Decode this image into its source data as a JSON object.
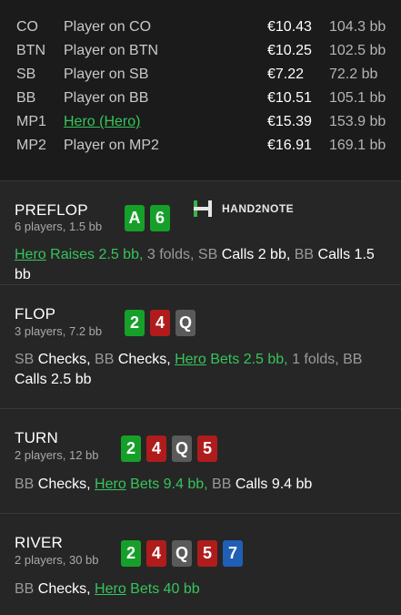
{
  "players": [
    {
      "pos": "CO",
      "name": "Player on CO",
      "stack": "€10.43",
      "bb": "104.3 bb",
      "hero": false
    },
    {
      "pos": "BTN",
      "name": "Player on BTN",
      "stack": "€10.25",
      "bb": "102.5 bb",
      "hero": false
    },
    {
      "pos": "SB",
      "name": "Player on SB",
      "stack": "€7.22",
      "bb": "72.2 bb",
      "hero": false
    },
    {
      "pos": "BB",
      "name": "Player on BB",
      "stack": "€10.51",
      "bb": "105.1 bb",
      "hero": false
    },
    {
      "pos": "MP1",
      "name": "Hero (Hero)",
      "stack": "€15.39",
      "bb": "153.9 bb",
      "hero": true
    },
    {
      "pos": "MP2",
      "name": "Player on MP2",
      "stack": "€16.91",
      "bb": "169.1 bb",
      "hero": false
    }
  ],
  "logo": {
    "text": "HAND2NOTE",
    "icon": "hand2note-logo-icon"
  },
  "streets": {
    "preflop": {
      "title": "PREFLOP",
      "sub": "6 players, 1.5 bb",
      "cards": [
        {
          "rank": "A",
          "suit": "clubs"
        },
        {
          "rank": "6",
          "suit": "clubs"
        }
      ],
      "actions": {
        "a1": "Hero",
        "a2": " Raises 2.5 bb,",
        "a3": " 3 folds,",
        "a4": " SB",
        "a5": " Calls 2 bb,",
        "a6": " BB",
        "a7": " Calls 1.5 bb"
      }
    },
    "flop": {
      "title": "FLOP",
      "sub": "3 players, 7.2 bb",
      "cards": [
        {
          "rank": "2",
          "suit": "clubs"
        },
        {
          "rank": "4",
          "suit": "hearts"
        },
        {
          "rank": "Q",
          "suit": "spades"
        }
      ],
      "actions": {
        "a1": "SB",
        "a2": " Checks,",
        "a3": " BB",
        "a4": " Checks,",
        "a5": "Hero",
        "a6": " Bets 2.5 bb,",
        "a7": " 1 folds,",
        "a8": " BB",
        "a9": " Calls 2.5 bb"
      }
    },
    "turn": {
      "title": "TURN",
      "sub": "2 players, 12 bb",
      "cards": [
        {
          "rank": "2",
          "suit": "clubs"
        },
        {
          "rank": "4",
          "suit": "hearts"
        },
        {
          "rank": "Q",
          "suit": "spades"
        },
        {
          "rank": "5",
          "suit": "hearts"
        }
      ],
      "actions": {
        "a1": "BB",
        "a2": " Checks,",
        "a3": "Hero",
        "a4": " Bets 9.4 bb,",
        "a5": " BB",
        "a6": " Calls 9.4 bb"
      }
    },
    "river": {
      "title": "RIVER",
      "sub": "2 players, 30 bb",
      "cards": [
        {
          "rank": "2",
          "suit": "clubs"
        },
        {
          "rank": "4",
          "suit": "hearts"
        },
        {
          "rank": "Q",
          "suit": "spades"
        },
        {
          "rank": "5",
          "suit": "hearts"
        },
        {
          "rank": "7",
          "suit": "diamonds"
        }
      ],
      "actions": {
        "a1": "BB",
        "a2": " Checks,",
        "a3": "Hero",
        "a4": " Bets 40 bb"
      }
    }
  },
  "colors": {
    "clubs": "#16a02a",
    "hearts": "#b01c1c",
    "spades": "#5a5a5a",
    "diamonds": "#1f5fb5",
    "hero": "#36c45a"
  }
}
